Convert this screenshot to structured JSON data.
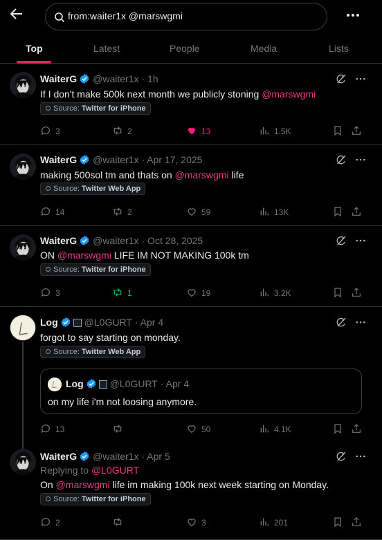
{
  "search": {
    "query": "from:waiter1x @marswgmi"
  },
  "tabs": [
    {
      "label": "Top"
    },
    {
      "label": "Latest"
    },
    {
      "label": "People"
    },
    {
      "label": "Media"
    },
    {
      "label": "Lists"
    }
  ],
  "colors": {
    "accent": "#e0245e",
    "mention": "#e8388b",
    "liked": "#f91880",
    "retweeted": "#00ba7c",
    "verified": "#1d9bf0"
  },
  "tweets": [
    {
      "name": "WaiterG",
      "handle": "@waiter1x",
      "time": "· 1h",
      "text_pre": "If I don't make 500k next month we publicly stoning ",
      "mention": "@marswgmi",
      "text_post": "",
      "source_label": "Source:",
      "source": "Twitter for iPhone",
      "replies": "3",
      "retweets": "2",
      "likes": "13",
      "views": "1.5K"
    },
    {
      "name": "WaiterG",
      "handle": "@waiter1x",
      "time": "· Apr 17, 2025",
      "text_pre": "making 500sol tm and thats on ",
      "mention": "@marswgmi",
      "text_post": " life",
      "source_label": "Source:",
      "source": "Twitter Web App",
      "replies": "14",
      "retweets": "2",
      "likes": "59",
      "views": "13K"
    },
    {
      "name": "WaiterG",
      "handle": "@waiter1x",
      "time": "· Oct 28, 2025",
      "text_pre": "ON ",
      "mention": "@marswgmi",
      "text_post": " LIFE IM NOT MAKING 100k tm",
      "source_label": "Source:",
      "source": "Twitter for iPhone",
      "replies": "3",
      "retweets": "1",
      "likes": "19",
      "views": "3.2K"
    },
    {
      "name": "Log",
      "handle": "@L0GURT",
      "time": "· Apr 4",
      "text": "forgot to say starting on monday.",
      "source_label": "Source:",
      "source": "Twitter Web App",
      "quote": {
        "name": "Log",
        "handle": "@L0GURT",
        "time": "· Apr 4",
        "text": "on my life i'm not loosing anymore."
      },
      "replies": "13",
      "retweets": "",
      "likes": "50",
      "views": "4.1K"
    },
    {
      "name": "WaiterG",
      "handle": "@waiter1x",
      "time": "· Apr 5",
      "replying_label": "Replying to ",
      "replying_to": "@L0GURT",
      "text_pre": "On ",
      "mention": "@marswgmi",
      "text_post": " life im making 100k next week starting on Monday.",
      "source_label": "Source:",
      "source": "Twitter for iPhone",
      "replies": "2",
      "retweets": "",
      "likes": "3",
      "views": "201"
    }
  ]
}
